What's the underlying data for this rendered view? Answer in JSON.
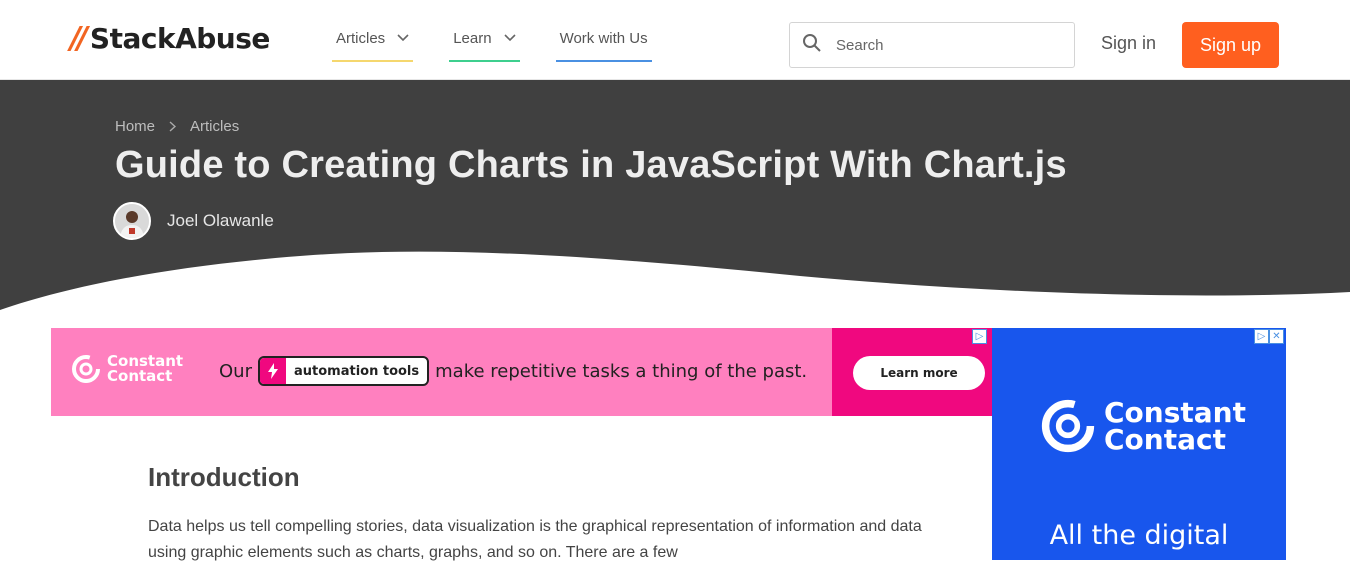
{
  "header": {
    "logo_mark": "//",
    "logo_text": "StackAbuse",
    "nav": [
      {
        "label": "Articles",
        "has_dropdown": true,
        "accent": "#f5d76e"
      },
      {
        "label": "Learn",
        "has_dropdown": true,
        "accent": "#3ecf8e"
      },
      {
        "label": "Work with Us",
        "has_dropdown": false,
        "accent": "#4a90e2"
      }
    ],
    "search_placeholder": "Search",
    "sign_in": "Sign in",
    "sign_up": "Sign up",
    "brand_color": "#ff5f1f"
  },
  "hero": {
    "breadcrumb": [
      "Home",
      "Articles"
    ],
    "title": "Guide to Creating Charts in JavaScript With Chart.js",
    "author": "Joel Olawanle",
    "bg_color": "#404040"
  },
  "ad_banner": {
    "brand_line1": "Constant",
    "brand_line2": "Contact",
    "text_before": "Our",
    "tag": "automation tools",
    "text_after": "make repetitive tasks a thing of the past.",
    "cta": "Learn more",
    "bg_color": "#ff80bf",
    "accent": "#f0087f"
  },
  "ad_side": {
    "brand_line1": "Constant",
    "brand_line2": "Contact",
    "headline": "All the digital",
    "bg_color": "#1856ed"
  },
  "article": {
    "heading": "Introduction",
    "paragraph": "Data helps us tell compelling stories, data visualization is the graphical representation of information and data using graphic elements such as charts, graphs, and so on. There are a few"
  }
}
